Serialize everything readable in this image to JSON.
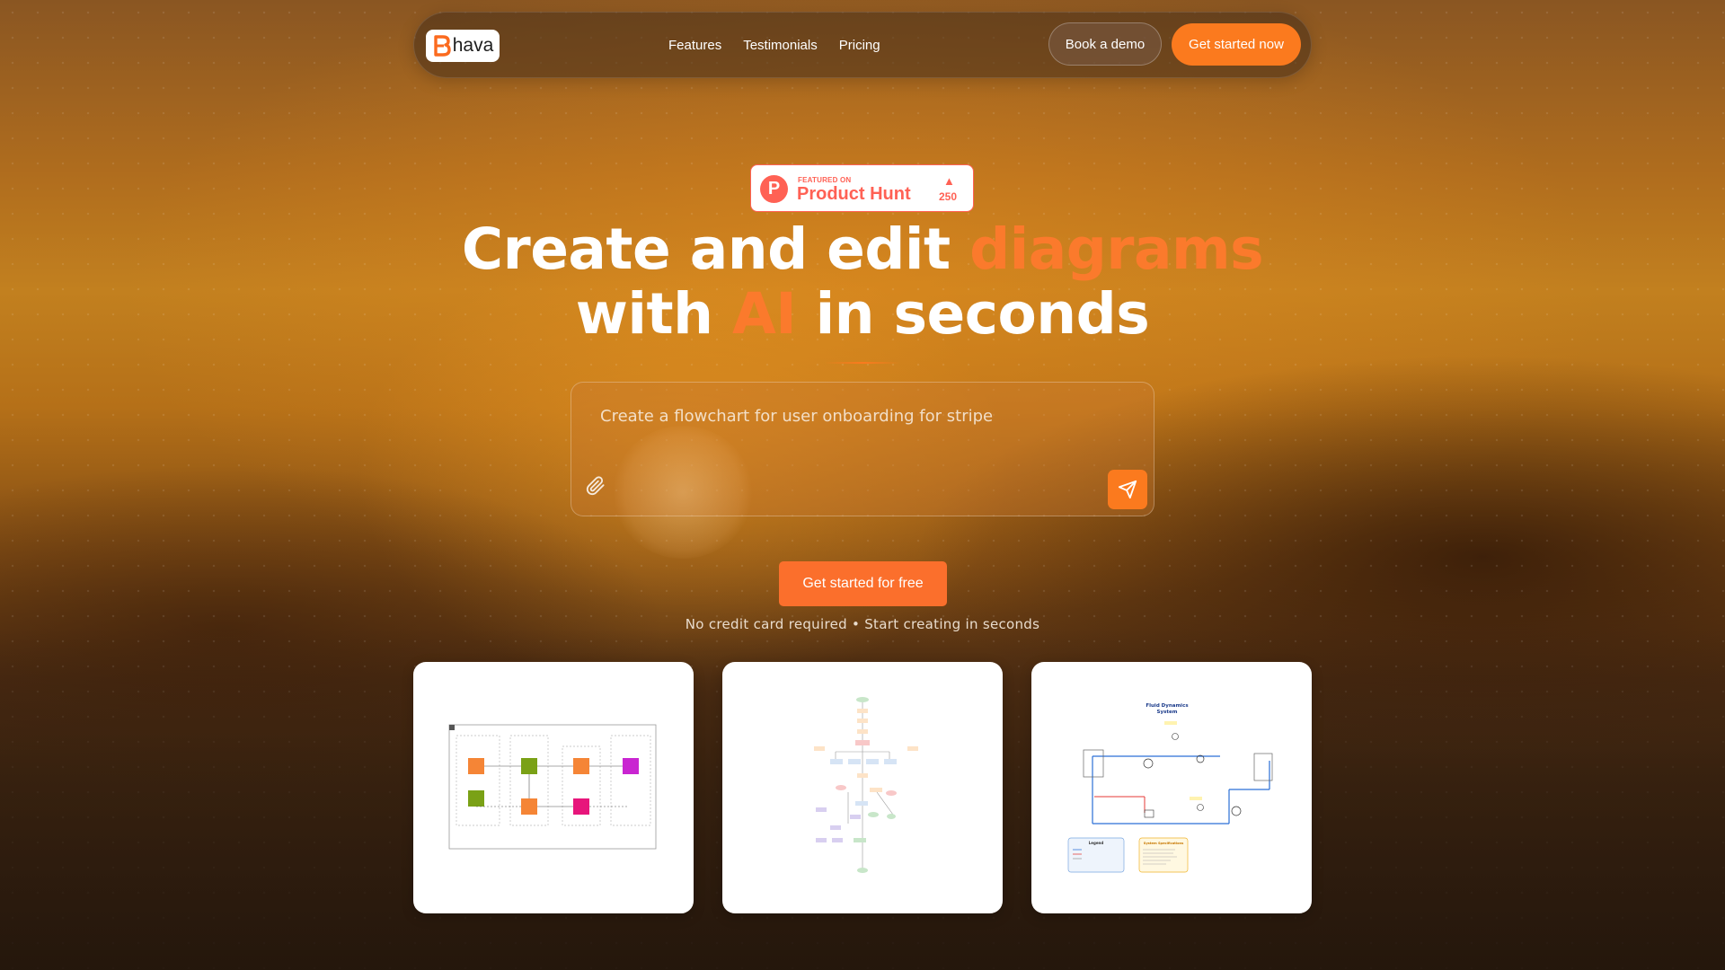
{
  "brand": {
    "name": "hava",
    "accent_color": "#fb7a1e"
  },
  "nav": {
    "links": [
      "Features",
      "Testimonials",
      "Pricing"
    ],
    "book_demo_label": "Book a demo",
    "get_started_label": "Get started now"
  },
  "product_hunt": {
    "featured_label": "FEATURED ON",
    "name": "Product Hunt",
    "logo_letter": "P",
    "votes": "250",
    "color": "#ff6154"
  },
  "hero": {
    "line1_part1": "Create and edit ",
    "line1_accent": "diagrams",
    "line2_part1": "with ",
    "line2_accent": "AI",
    "line2_part2": " in seconds"
  },
  "prompt": {
    "placeholder": "Create a flowchart for user onboarding for stripe",
    "attach_icon": "paperclip-icon",
    "send_icon": "send-icon"
  },
  "cta": {
    "label": "Get started for free",
    "subtext": "No credit card required • Start creating in seconds"
  },
  "examples": {
    "cards": [
      {
        "kind": "aws-architecture-diagram"
      },
      {
        "kind": "flowchart"
      },
      {
        "kind": "fluid-dynamics-diagram",
        "title_line1": "Fluid Dynamics",
        "title_line2": "System",
        "legend_title": "Legend",
        "specs_title": "System Specifications"
      }
    ]
  }
}
